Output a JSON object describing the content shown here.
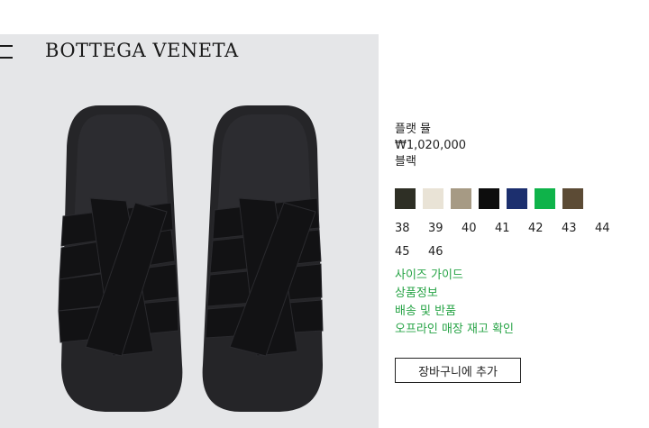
{
  "header": {
    "brand": "BOTTEGA VENETA",
    "menu_icon": "hamburger-menu-icon"
  },
  "product": {
    "name": "플랫 뮬",
    "price": "₩1,020,000",
    "color_name": "블랙",
    "image_icon": "woven-flat-mule-sandal-image",
    "swatches": [
      {
        "color": "#2e2f25"
      },
      {
        "color": "#e9e3d6"
      },
      {
        "color": "#a69a84"
      },
      {
        "color": "#0d0d0d"
      },
      {
        "color": "#1c2f6e"
      },
      {
        "color": "#0fb34a"
      },
      {
        "color": "#5c4b35"
      }
    ],
    "sizes": [
      "38",
      "39",
      "40",
      "41",
      "42",
      "43",
      "44",
      "45",
      "46"
    ],
    "links": {
      "size_guide": "사이즈 가이드",
      "product_info": "상품정보",
      "shipping_returns": "배송 및 반품",
      "store_stock": "오프라인 매장 재고 확인"
    },
    "add_to_cart": "장바구니에 추가"
  },
  "colors": {
    "accent_link": "#26a345",
    "image_background": "#e5e6e8"
  }
}
